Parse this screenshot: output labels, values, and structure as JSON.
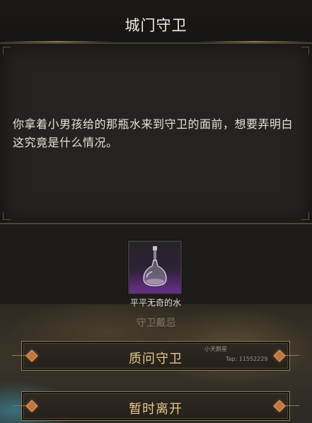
{
  "dialog": {
    "title": "城门守卫",
    "story_text": "你拿着小男孩给的那瓶水来到守卫的面前，想要弄明白这究竟是什么情况。"
  },
  "item": {
    "name": "平平无奇的水",
    "icon": "water-bottle-icon"
  },
  "background": {
    "caption": "守卫戴忌"
  },
  "choices": [
    {
      "label": "质问守卫"
    },
    {
      "label": "暂时离开"
    }
  ],
  "watermark": {
    "name": "小天鹅星",
    "tap": "Tap: 11552229"
  },
  "colors": {
    "accent_gold": "#e6c48e",
    "diamond_orange": "#c07640",
    "item_purple": "#6a2f8c"
  }
}
